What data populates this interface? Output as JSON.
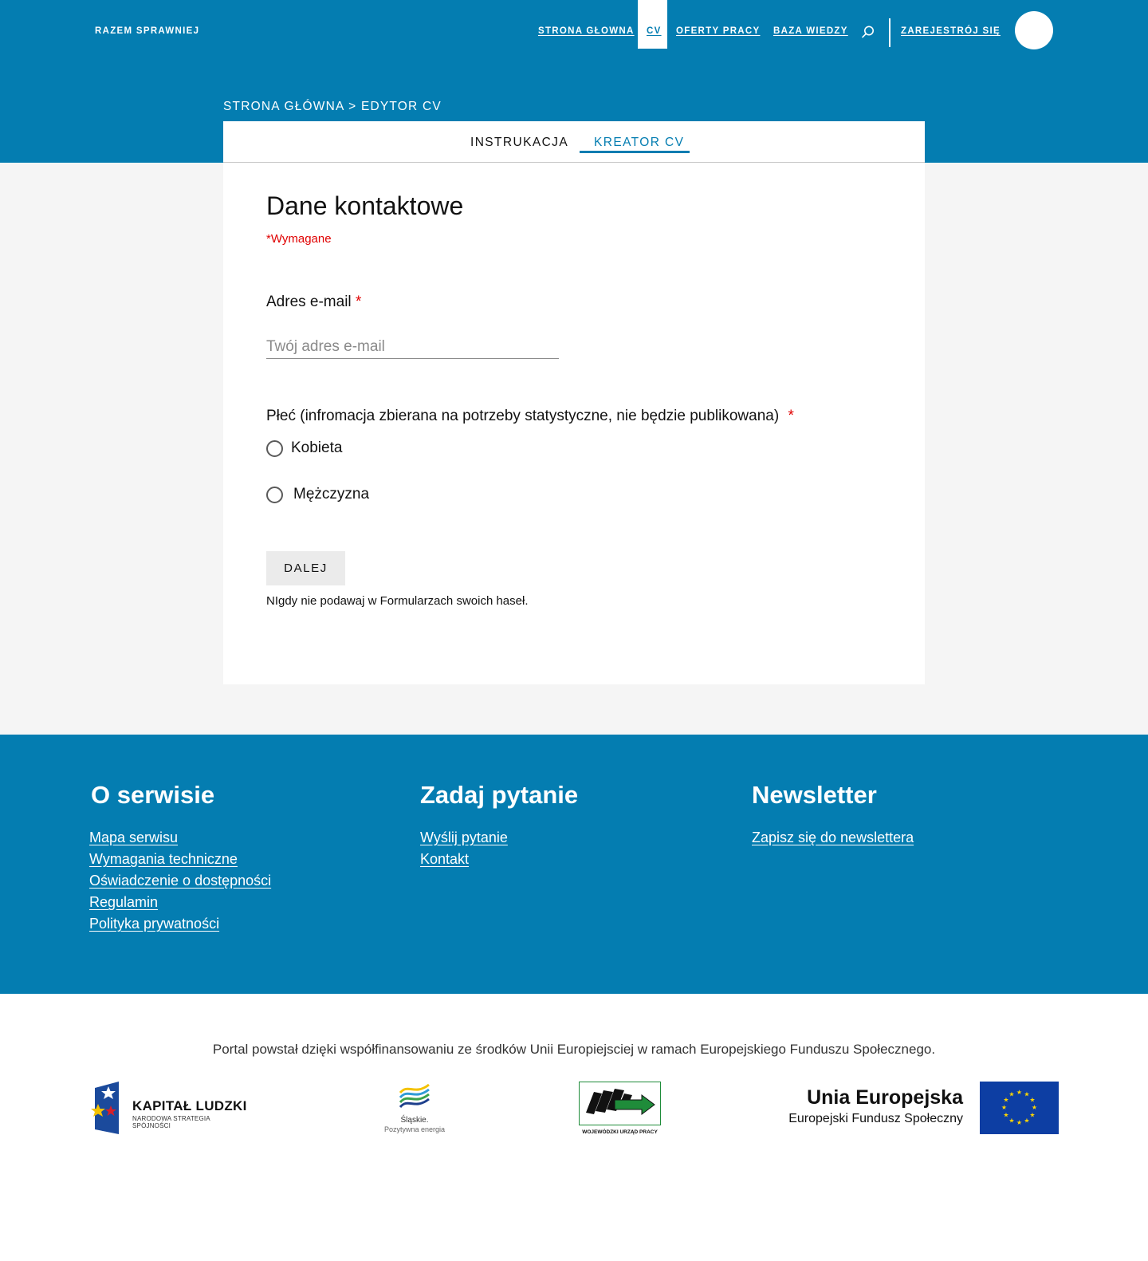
{
  "header": {
    "brand": "RAZEM SPRAWNIEJ",
    "nav": [
      {
        "label": "STRONA GŁOWNA"
      },
      {
        "label": "CV"
      },
      {
        "label": "OFERTY PRACY"
      },
      {
        "label": "BAZA WIEDZY"
      }
    ],
    "register": "ZAREJESTRÓJ SIĘ",
    "search_icon": "search-icon"
  },
  "breadcrumb": "STRONA GŁÓWNA > EDYTOR CV",
  "tabs": [
    {
      "label": "INSTRUKACJA"
    },
    {
      "label": "KREATOR CV"
    }
  ],
  "form": {
    "title": "Dane kontaktowe",
    "required_note": "*Wymagane",
    "email_label": "Adres e-mail",
    "email_placeholder": "Twój adres e-mail",
    "email_value": "",
    "required_star": "*",
    "gender_label": "Płeć (infromacja zbierana na potrzeby statystyczne, nie będzie publikowana)",
    "gender_options": [
      {
        "label": "Kobieta"
      },
      {
        "label": "Mężczyzna"
      }
    ],
    "next_button": "DALEJ",
    "hint": "NIgdy nie podawaj w Formularzach swoich haseł."
  },
  "footer": {
    "about": {
      "title": "O serwisie",
      "links": [
        "Mapa serwisu",
        "Wymagania techniczne",
        "Oświadczenie o dostępności",
        "Regulamin",
        "Polityka prywatności"
      ]
    },
    "ask": {
      "title": "Zadaj pytanie",
      "links": [
        "Wyślij pytanie",
        "Kontakt"
      ]
    },
    "newsletter": {
      "title": "Newsletter",
      "links": [
        "Zapisz się do newslettera"
      ]
    }
  },
  "funding_text": "Portal powstał dzięki współfinansowaniu ze środków Unii Europiejsciej w ramach Europejskiego Funduszu Społecznego.",
  "logos": {
    "kapital": {
      "title": "KAPITAŁ LUDZKI",
      "subtitle": "NARODOWA STRATEGIA SPÓJNOŚCI"
    },
    "slaskie": {
      "title": "Śląskie.",
      "subtitle": "Pozytywna energia"
    },
    "wup": {
      "caption": "WOJEWÓDZKI URZĄD PRACY"
    },
    "ue": {
      "title": "Unia Europejska",
      "subtitle": "Europejski Fundusz Społeczny"
    }
  },
  "colors": {
    "brand_blue": "#047db1",
    "required_red": "#e00000",
    "background_gray": "#f5f5f5"
  }
}
